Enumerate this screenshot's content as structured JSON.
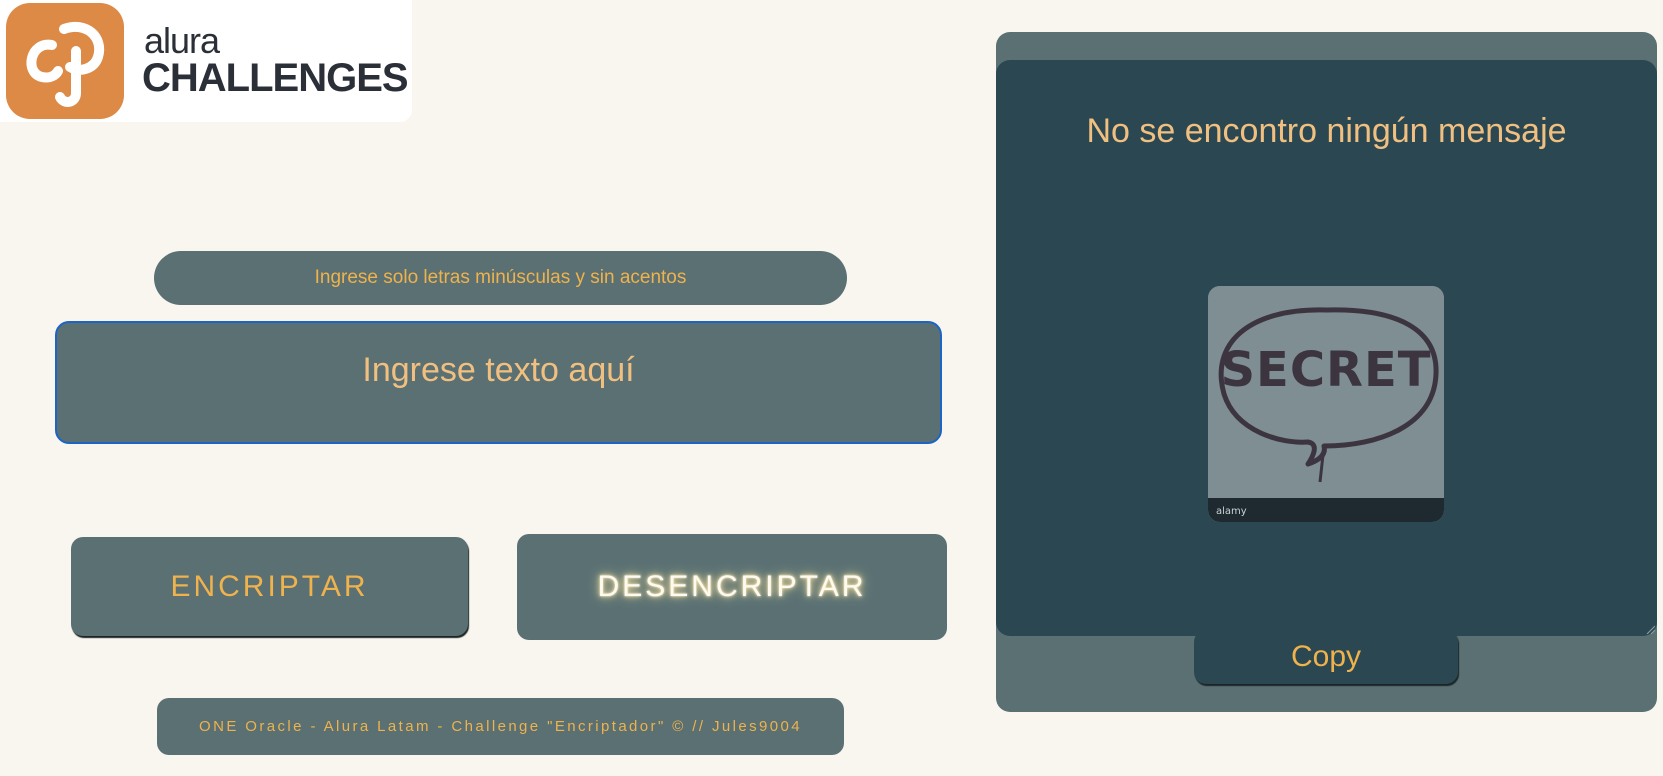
{
  "logo": {
    "top_text": "alura",
    "bottom_text": "CHALLENGES",
    "icon": "alura-logo-icon",
    "brand_color": "#dc8a46"
  },
  "hint": {
    "text": "Ingrese solo letras minúsculas y sin acentos"
  },
  "input": {
    "placeholder": "Ingrese texto aquí",
    "value": ""
  },
  "buttons": {
    "encrypt_label": "ENCRIPTAR",
    "decrypt_label": "DESENCRIPTAR"
  },
  "footer": {
    "text": "ONE Oracle - Alura Latam - Challenge \"Encriptador\" © // Jules9004"
  },
  "output": {
    "message": "No se encontro ningún mensaje",
    "image_word": "SECRET",
    "image_watermark": "alamy",
    "copy_label": "Copy"
  },
  "colors": {
    "page_bg": "#f8f6ee",
    "panel_bg": "#5a7073",
    "output_bg": "#2b4852",
    "accent": "#efb24c",
    "input_border": "#1d64c4"
  }
}
